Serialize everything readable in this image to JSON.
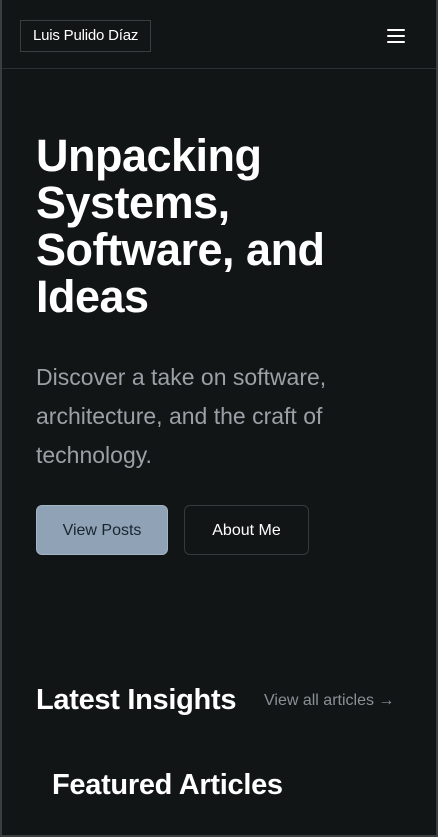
{
  "header": {
    "brand": "Luis Pulido Díaz",
    "menu_icon": "hamburger-menu-icon"
  },
  "hero": {
    "title": "Unpacking Systems, Software, and Ideas",
    "subtitle": "Discover a take on software, architecture, and the craft of technology.",
    "primary_button": "View Posts",
    "secondary_button": "About Me"
  },
  "insights": {
    "title": "Latest Insights",
    "view_all": "View all articles →"
  },
  "featured": {
    "title": "Featured Articles"
  },
  "colors": {
    "background": "#111516",
    "primary_button": "#8fa2b6",
    "muted_text": "#9aa0a6"
  }
}
